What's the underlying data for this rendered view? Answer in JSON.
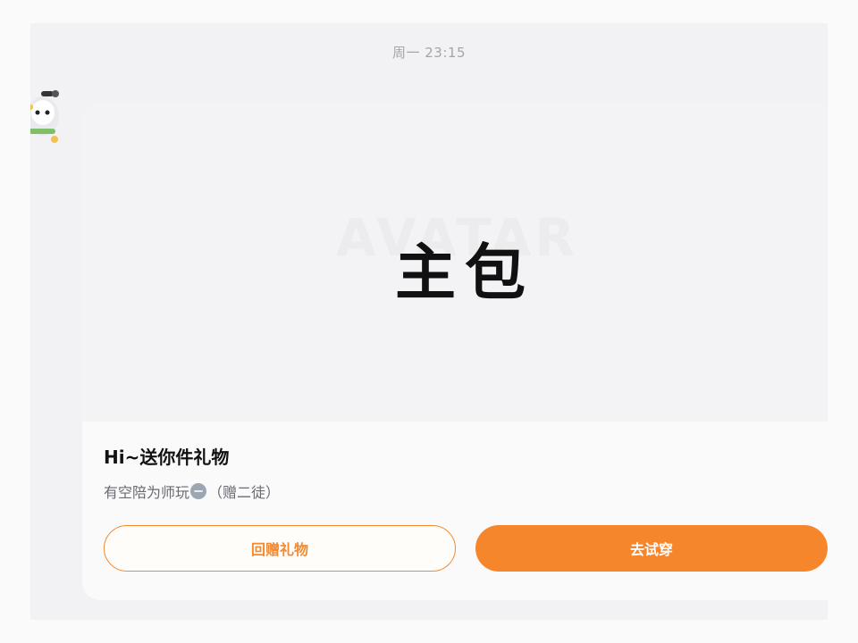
{
  "chat": {
    "timestamp": "周一 23:15"
  },
  "gift_card": {
    "image_text": "主包",
    "image_watermark": "AVATAR",
    "title": "Hi~送你件礼物",
    "description_prefix": "有空陪为师玩",
    "emoji_icon": "emoji-face-icon",
    "description_suffix": "（赠二徒）",
    "buttons": {
      "return_gift_label": "回赠礼物",
      "try_on_label": "去试穿"
    }
  },
  "colors": {
    "accent": "#f6862c",
    "accent_outline": "#f28a31",
    "page_background": "#f2f2f4",
    "card_background": "#fafafb"
  }
}
